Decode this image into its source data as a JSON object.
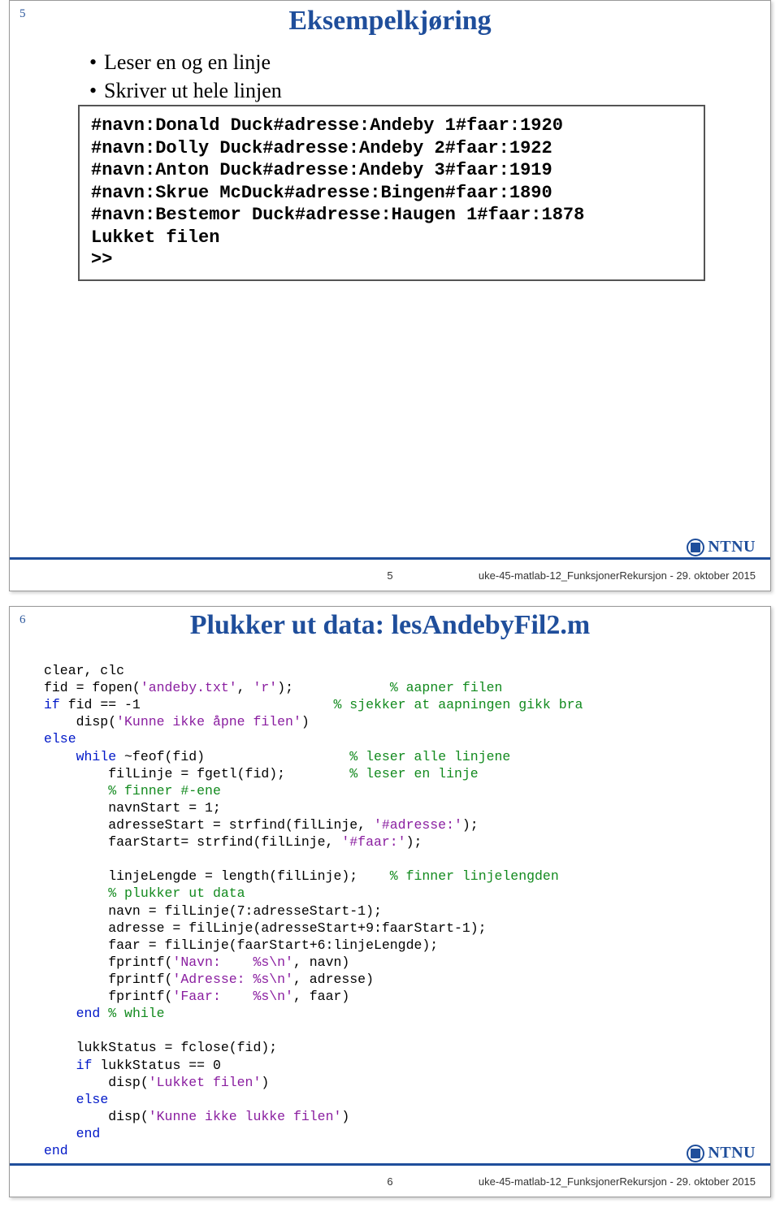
{
  "slide1": {
    "num_top": "5",
    "title": "Eksempelkjøring",
    "bullets": [
      "Leser en og en linje",
      "Skriver ut hele linjen"
    ],
    "console": "#navn:Donald Duck#adresse:Andeby 1#faar:1920\n#navn:Dolly Duck#adresse:Andeby 2#faar:1922\n#navn:Anton Duck#adresse:Andeby 3#faar:1919\n#navn:Skrue McDuck#adresse:Bingen#faar:1890\n#navn:Bestemor Duck#adresse:Haugen 1#faar:1878\nLukket filen\n>>",
    "footer_page": "5",
    "footer_meta": "uke-45-matlab-12_FunksjonerRekursjon - 29. oktober 2015",
    "logo": "NTNU"
  },
  "slide2": {
    "num_top": "6",
    "title": "Plukker ut data: lesAndebyFil2.m",
    "code": {
      "l01a": "clear, clc",
      "l02a": "fid = fopen(",
      "l02b": "'andeby.txt'",
      "l02c": ", ",
      "l02d": "'r'",
      "l02e": ");            ",
      "l02f": "% aapner filen",
      "l03a": "if",
      "l03b": " fid == -1                        ",
      "l03c": "% sjekker at aapningen gikk bra",
      "l04a": "    disp(",
      "l04b": "'Kunne ikke åpne filen'",
      "l04c": ")",
      "l05a": "else",
      "l06a": "    ",
      "l06b": "while",
      "l06c": " ~feof(fid)                  ",
      "l06d": "% leser alle linjene",
      "l07a": "        filLinje = fgetl(fid);        ",
      "l07b": "% leser en linje",
      "l08a": "        ",
      "l08b": "% finner #-ene",
      "l09a": "        navnStart = 1;",
      "l10a": "        adresseStart = strfind(filLinje, ",
      "l10b": "'#adresse:'",
      "l10c": ");",
      "l11a": "        faarStart= strfind(filLinje, ",
      "l11b": "'#faar:'",
      "l11c": ");",
      "l12": "",
      "l13a": "        linjeLengde = length(filLinje);    ",
      "l13b": "% finner linjelengden",
      "l14a": "        ",
      "l14b": "% plukker ut data",
      "l15a": "        navn = filLinje(7:adresseStart-1);",
      "l16a": "        adresse = filLinje(adresseStart+9:faarStart-1);",
      "l17a": "        faar = filLinje(faarStart+6:linjeLengde);",
      "l18a": "        fprintf(",
      "l18b": "'Navn:    %s\\n'",
      "l18c": ", navn)",
      "l19a": "        fprintf(",
      "l19b": "'Adresse: %s\\n'",
      "l19c": ", adresse)",
      "l20a": "        fprintf(",
      "l20b": "'Faar:    %s\\n'",
      "l20c": ", faar)",
      "l21a": "    ",
      "l21b": "end",
      "l21c": " ",
      "l21d": "% while",
      "l22": "",
      "l23a": "    lukkStatus = fclose(fid);",
      "l24a": "    ",
      "l24b": "if",
      "l24c": " lukkStatus == 0",
      "l25a": "        disp(",
      "l25b": "'Lukket filen'",
      "l25c": ")",
      "l26a": "    ",
      "l26b": "else",
      "l27a": "        disp(",
      "l27b": "'Kunne ikke lukke filen'",
      "l27c": ")",
      "l28a": "    ",
      "l28b": "end",
      "l29a": "end"
    },
    "footer_page": "6",
    "footer_meta": "uke-45-matlab-12_FunksjonerRekursjon - 29. oktober 2015",
    "logo": "NTNU"
  }
}
